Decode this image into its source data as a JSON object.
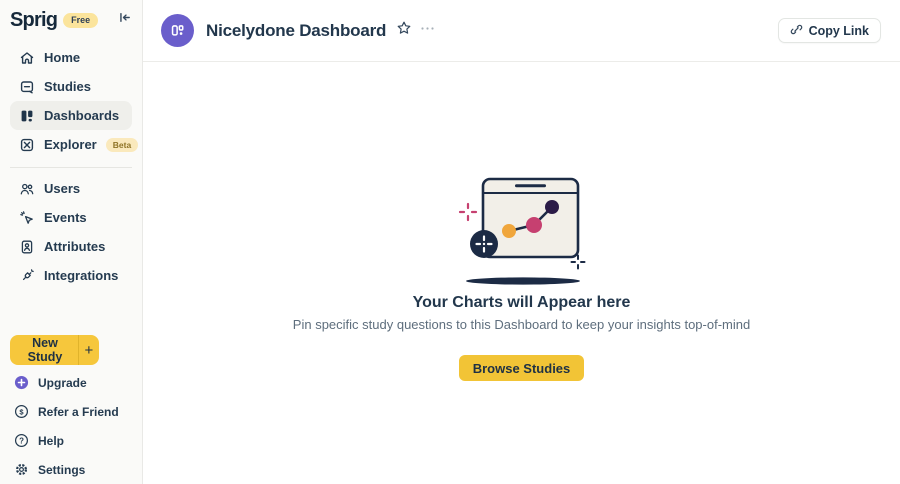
{
  "sidebar": {
    "logo": "Sprig",
    "plan_badge": "Free",
    "nav": [
      {
        "label": "Home"
      },
      {
        "label": "Studies"
      },
      {
        "label": "Dashboards"
      },
      {
        "label": "Explorer",
        "badge": "Beta"
      },
      {
        "label": "Users"
      },
      {
        "label": "Events"
      },
      {
        "label": "Attributes"
      },
      {
        "label": "Integrations"
      }
    ],
    "new_study": {
      "label": "New Study",
      "plus": "+"
    },
    "footer": [
      {
        "label": "Upgrade"
      },
      {
        "label": "Refer a Friend"
      },
      {
        "label": "Help"
      },
      {
        "label": "Settings"
      }
    ]
  },
  "header": {
    "title": "Nicelydone Dashboard",
    "copy_link_label": "Copy Link"
  },
  "empty_state": {
    "heading": "Your Charts will Appear here",
    "subtext": "Pin specific study questions to this Dashboard to keep your insights top-of-mind",
    "button_label": "Browse Studies"
  },
  "colors": {
    "brand_yellow": "#F6C73C",
    "brand_purple": "#6A5ECB",
    "text_dark": "#22374C",
    "text_muted": "#5E6E7D",
    "illustration_navy": "#1C2B45",
    "illustration_pink": "#C64070",
    "illustration_orange": "#F0A63C",
    "illustration_plum": "#2B1B47"
  }
}
